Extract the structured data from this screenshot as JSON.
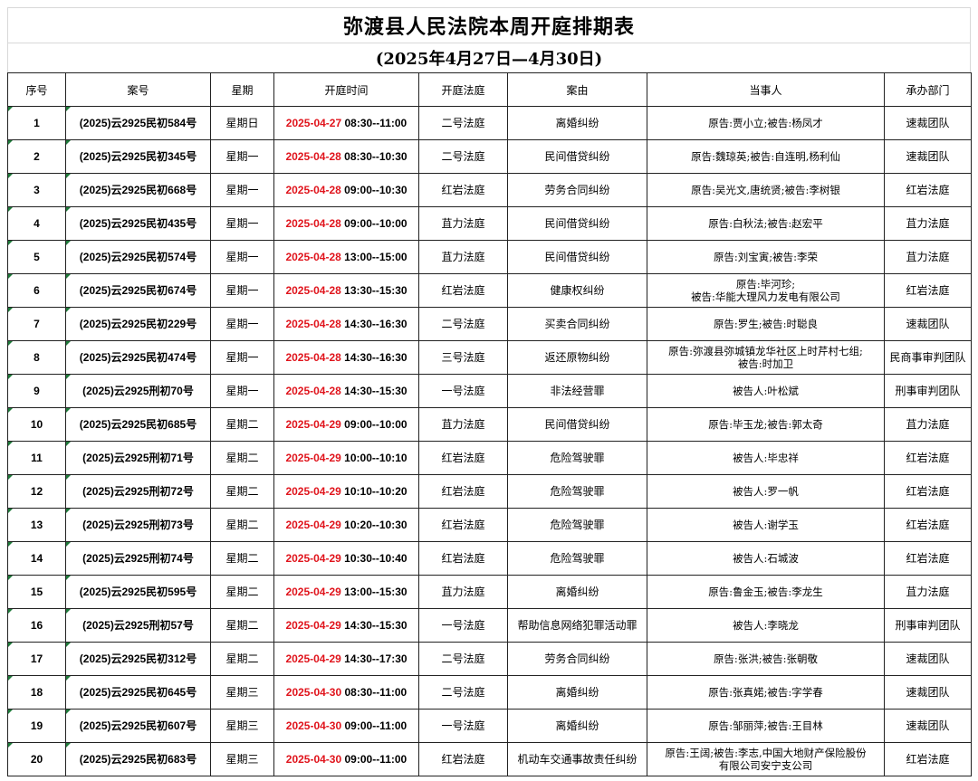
{
  "title": "弥渡县人民法院本周开庭排期表",
  "subtitle": "(2025年4月27日—4月30日)",
  "headers": [
    "序号",
    "案号",
    "星期",
    "开庭时间",
    "开庭法庭",
    "案由",
    "当事人",
    "承办部门"
  ],
  "rows": [
    {
      "no": "1",
      "case": "(2025)云2925民初584号",
      "weekday": "星期日",
      "date": "2025-04-27",
      "time": "08:30--11:00",
      "court": "二号法庭",
      "cause": "离婚纠纷",
      "party": "原告:贾小立;被告:杨凤才",
      "dept": "速裁团队"
    },
    {
      "no": "2",
      "case": "(2025)云2925民初345号",
      "weekday": "星期一",
      "date": "2025-04-28",
      "time": "08:30--10:30",
      "court": "二号法庭",
      "cause": "民间借贷纠纷",
      "party": "原告:魏琼英;被告:自连明,杨利仙",
      "dept": "速裁团队"
    },
    {
      "no": "3",
      "case": "(2025)云2925民初668号",
      "weekday": "星期一",
      "date": "2025-04-28",
      "time": "09:00--10:30",
      "court": "红岩法庭",
      "cause": "劳务合同纠纷",
      "party": "原告:吴光文,唐统贤;被告:李树银",
      "dept": "红岩法庭"
    },
    {
      "no": "4",
      "case": "(2025)云2925民初435号",
      "weekday": "星期一",
      "date": "2025-04-28",
      "time": "09:00--10:00",
      "court": "苴力法庭",
      "cause": "民间借贷纠纷",
      "party": "原告:白秋法;被告:赵宏平",
      "dept": "苴力法庭"
    },
    {
      "no": "5",
      "case": "(2025)云2925民初574号",
      "weekday": "星期一",
      "date": "2025-04-28",
      "time": "13:00--15:00",
      "court": "苴力法庭",
      "cause": "民间借贷纠纷",
      "party": "原告:刘宝寅;被告:李荣",
      "dept": "苴力法庭"
    },
    {
      "no": "6",
      "case": "(2025)云2925民初674号",
      "weekday": "星期一",
      "date": "2025-04-28",
      "time": "13:30--15:30",
      "court": "红岩法庭",
      "cause": "健康权纠纷",
      "party": "原告:毕河珍;\n被告:华能大理风力发电有限公司",
      "dept": "红岩法庭"
    },
    {
      "no": "7",
      "case": "(2025)云2925民初229号",
      "weekday": "星期一",
      "date": "2025-04-28",
      "time": "14:30--16:30",
      "court": "二号法庭",
      "cause": "买卖合同纠纷",
      "party": "原告:罗生;被告:时聪良",
      "dept": "速裁团队"
    },
    {
      "no": "8",
      "case": "(2025)云2925民初474号",
      "weekday": "星期一",
      "date": "2025-04-28",
      "time": "14:30--16:30",
      "court": "三号法庭",
      "cause": "返还原物纠纷",
      "party": "原告:弥渡县弥城镇龙华社区上时芹村七组;\n被告:时加卫",
      "dept": "民商事审判团队"
    },
    {
      "no": "9",
      "case": "(2025)云2925刑初70号",
      "weekday": "星期一",
      "date": "2025-04-28",
      "time": "14:30--15:30",
      "court": "一号法庭",
      "cause": "非法经营罪",
      "party": "被告人:叶松斌",
      "dept": "刑事审判团队"
    },
    {
      "no": "10",
      "case": "(2025)云2925民初685号",
      "weekday": "星期二",
      "date": "2025-04-29",
      "time": "09:00--10:00",
      "court": "苴力法庭",
      "cause": "民间借贷纠纷",
      "party": "原告:毕玉龙;被告:郭太奇",
      "dept": "苴力法庭"
    },
    {
      "no": "11",
      "case": "(2025)云2925刑初71号",
      "weekday": "星期二",
      "date": "2025-04-29",
      "time": "10:00--10:10",
      "court": "红岩法庭",
      "cause": "危险驾驶罪",
      "party": "被告人:毕忠祥",
      "dept": "红岩法庭"
    },
    {
      "no": "12",
      "case": "(2025)云2925刑初72号",
      "weekday": "星期二",
      "date": "2025-04-29",
      "time": "10:10--10:20",
      "court": "红岩法庭",
      "cause": "危险驾驶罪",
      "party": "被告人:罗一帆",
      "dept": "红岩法庭"
    },
    {
      "no": "13",
      "case": "(2025)云2925刑初73号",
      "weekday": "星期二",
      "date": "2025-04-29",
      "time": "10:20--10:30",
      "court": "红岩法庭",
      "cause": "危险驾驶罪",
      "party": "被告人:谢学玉",
      "dept": "红岩法庭"
    },
    {
      "no": "14",
      "case": "(2025)云2925刑初74号",
      "weekday": "星期二",
      "date": "2025-04-29",
      "time": "10:30--10:40",
      "court": "红岩法庭",
      "cause": "危险驾驶罪",
      "party": "被告人:石城波",
      "dept": "红岩法庭"
    },
    {
      "no": "15",
      "case": "(2025)云2925民初595号",
      "weekday": "星期二",
      "date": "2025-04-29",
      "time": "13:00--15:30",
      "court": "苴力法庭",
      "cause": "离婚纠纷",
      "party": "原告:鲁金玉;被告:李龙生",
      "dept": "苴力法庭"
    },
    {
      "no": "16",
      "case": "(2025)云2925刑初57号",
      "weekday": "星期二",
      "date": "2025-04-29",
      "time": "14:30--15:30",
      "court": "一号法庭",
      "cause": "帮助信息网络犯罪活动罪",
      "party": "被告人:李晓龙",
      "dept": "刑事审判团队"
    },
    {
      "no": "17",
      "case": "(2025)云2925民初312号",
      "weekday": "星期二",
      "date": "2025-04-29",
      "time": "14:30--17:30",
      "court": "二号法庭",
      "cause": "劳务合同纠纷",
      "party": "原告:张洪;被告:张朝敬",
      "dept": "速裁团队"
    },
    {
      "no": "18",
      "case": "(2025)云2925民初645号",
      "weekday": "星期三",
      "date": "2025-04-30",
      "time": "08:30--11:00",
      "court": "二号法庭",
      "cause": "离婚纠纷",
      "party": "原告:张真婼;被告:字学春",
      "dept": "速裁团队"
    },
    {
      "no": "19",
      "case": "(2025)云2925民初607号",
      "weekday": "星期三",
      "date": "2025-04-30",
      "time": "09:00--11:00",
      "court": "一号法庭",
      "cause": "离婚纠纷",
      "party": "原告:邹丽萍;被告:王目林",
      "dept": "速裁团队"
    },
    {
      "no": "20",
      "case": "(2025)云2925民初683号",
      "weekday": "星期三",
      "date": "2025-04-30",
      "time": "09:00--11:00",
      "court": "红岩法庭",
      "cause": "机动车交通事故责任纠纷",
      "party": "原告:王阔;被告:李志,中国大地财产保险股份\n有限公司安宁支公司",
      "dept": "红岩法庭"
    }
  ]
}
